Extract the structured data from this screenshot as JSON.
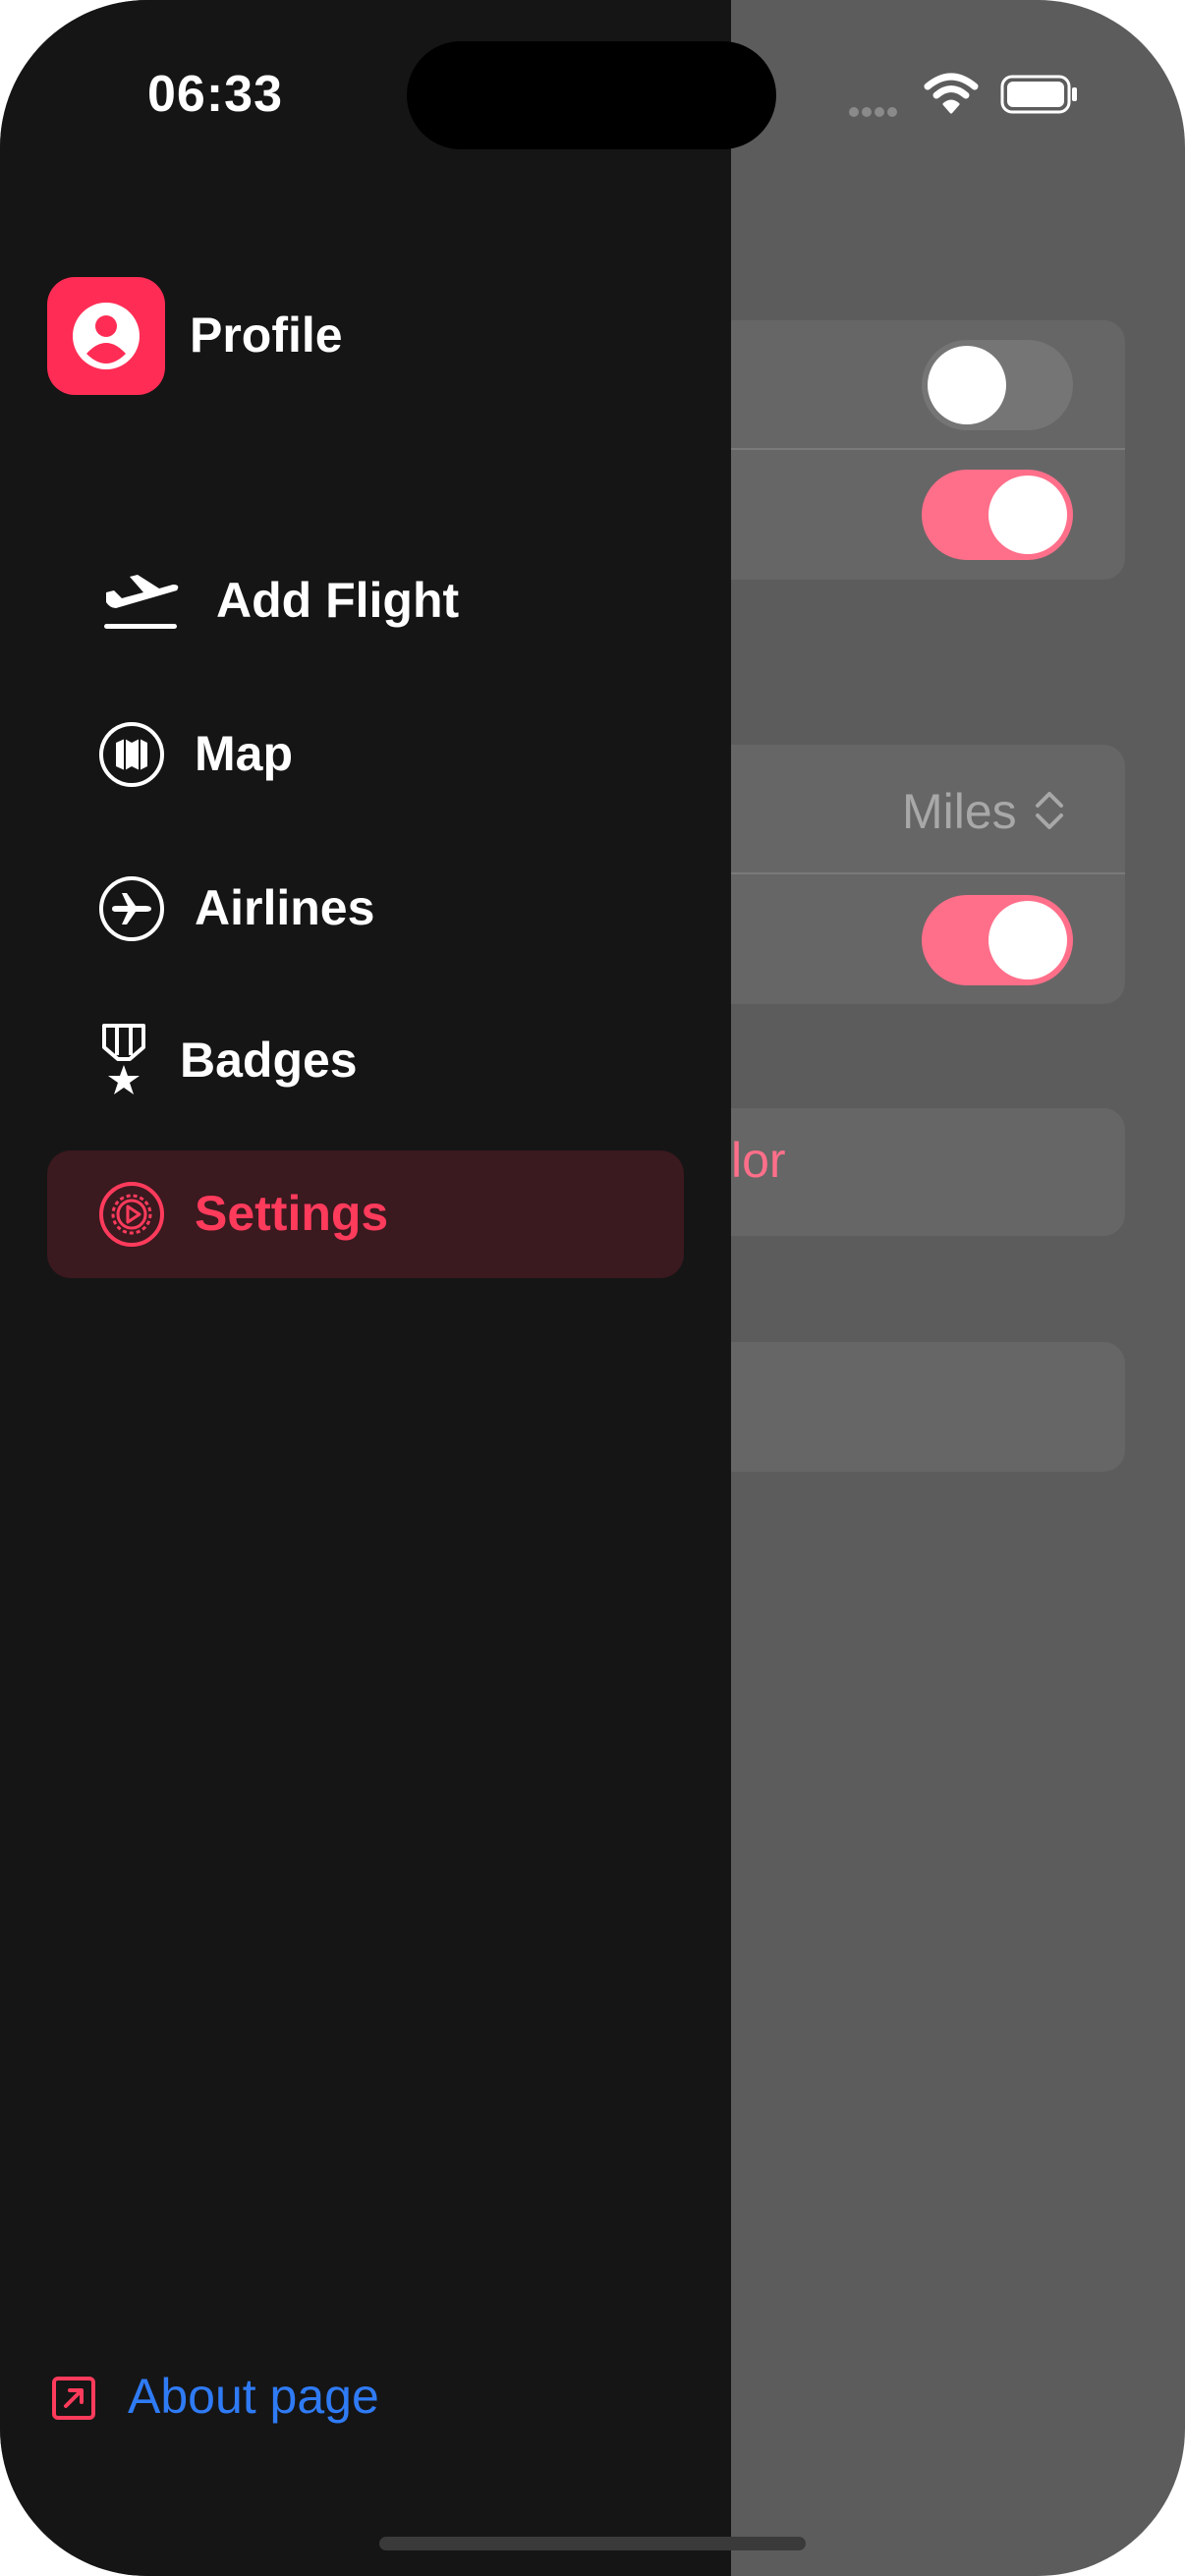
{
  "status_bar": {
    "time": "06:33"
  },
  "drawer": {
    "profile": {
      "label": "Profile",
      "icon": "person-icon"
    },
    "menu": [
      {
        "id": "add-flight",
        "label": "Add Flight",
        "icon": "airplane-departure-icon",
        "selected": false
      },
      {
        "id": "map",
        "label": "Map",
        "icon": "map-icon",
        "selected": false
      },
      {
        "id": "airlines",
        "label": "Airlines",
        "icon": "airplane-circle-icon",
        "selected": false
      },
      {
        "id": "badges",
        "label": "Badges",
        "icon": "medal-icon",
        "selected": false
      },
      {
        "id": "settings",
        "label": "Settings",
        "icon": "gear-icon",
        "selected": true
      }
    ],
    "about": {
      "label": "About page",
      "icon": "external-link-icon"
    }
  },
  "background_settings": {
    "distance_unit_value": "Miles",
    "color_fragment": "lor",
    "toggles": [
      false,
      true,
      true
    ]
  },
  "colors": {
    "accent": "#ff2d55",
    "selected_bg": "#3a191f",
    "drawer_bg": "#151515",
    "link": "#2f7bf5",
    "toggle_on": "#ff6f8a"
  }
}
